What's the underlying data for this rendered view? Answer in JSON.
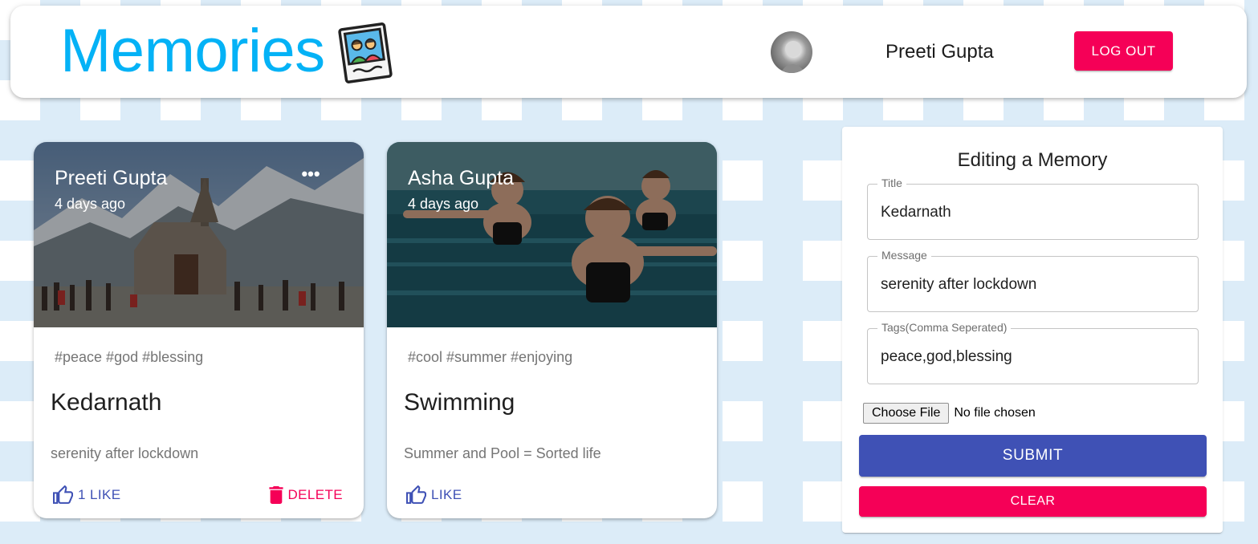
{
  "header": {
    "brand_title": "Memories",
    "user_name": "Preeti Gupta",
    "logout_label": "LOG OUT",
    "brand_color": "#04b2f6"
  },
  "posts": [
    {
      "author": "Preeti Gupta",
      "time": "4 days ago",
      "tags": "#peace #god #blessing",
      "title": "Kedarnath",
      "message": "serenity after lockdown",
      "like_label": "1 LIKE",
      "delete_label": "DELETE",
      "more_icon": "more-horiz-icon"
    },
    {
      "author": "Asha Gupta",
      "time": "4 days ago",
      "tags": "#cool #summer #enjoying",
      "title": "Swimming",
      "message": "Summer and Pool = Sorted life",
      "like_label": "LIKE"
    }
  ],
  "form": {
    "heading": "Editing a Memory",
    "title_label": "Title",
    "title_value": "Kedarnath",
    "message_label": "Message",
    "message_value": "serenity after lockdown",
    "tags_label": "Tags(Comma Seperated)",
    "tags_value": "peace,god,blessing",
    "file_button": "Choose File",
    "file_status": "No file chosen",
    "submit_label": "SUBMIT",
    "clear_label": "CLEAR"
  },
  "colors": {
    "primary": "#3f51b5",
    "secondary": "#f50057",
    "background_pattern": "#dcecf8"
  }
}
